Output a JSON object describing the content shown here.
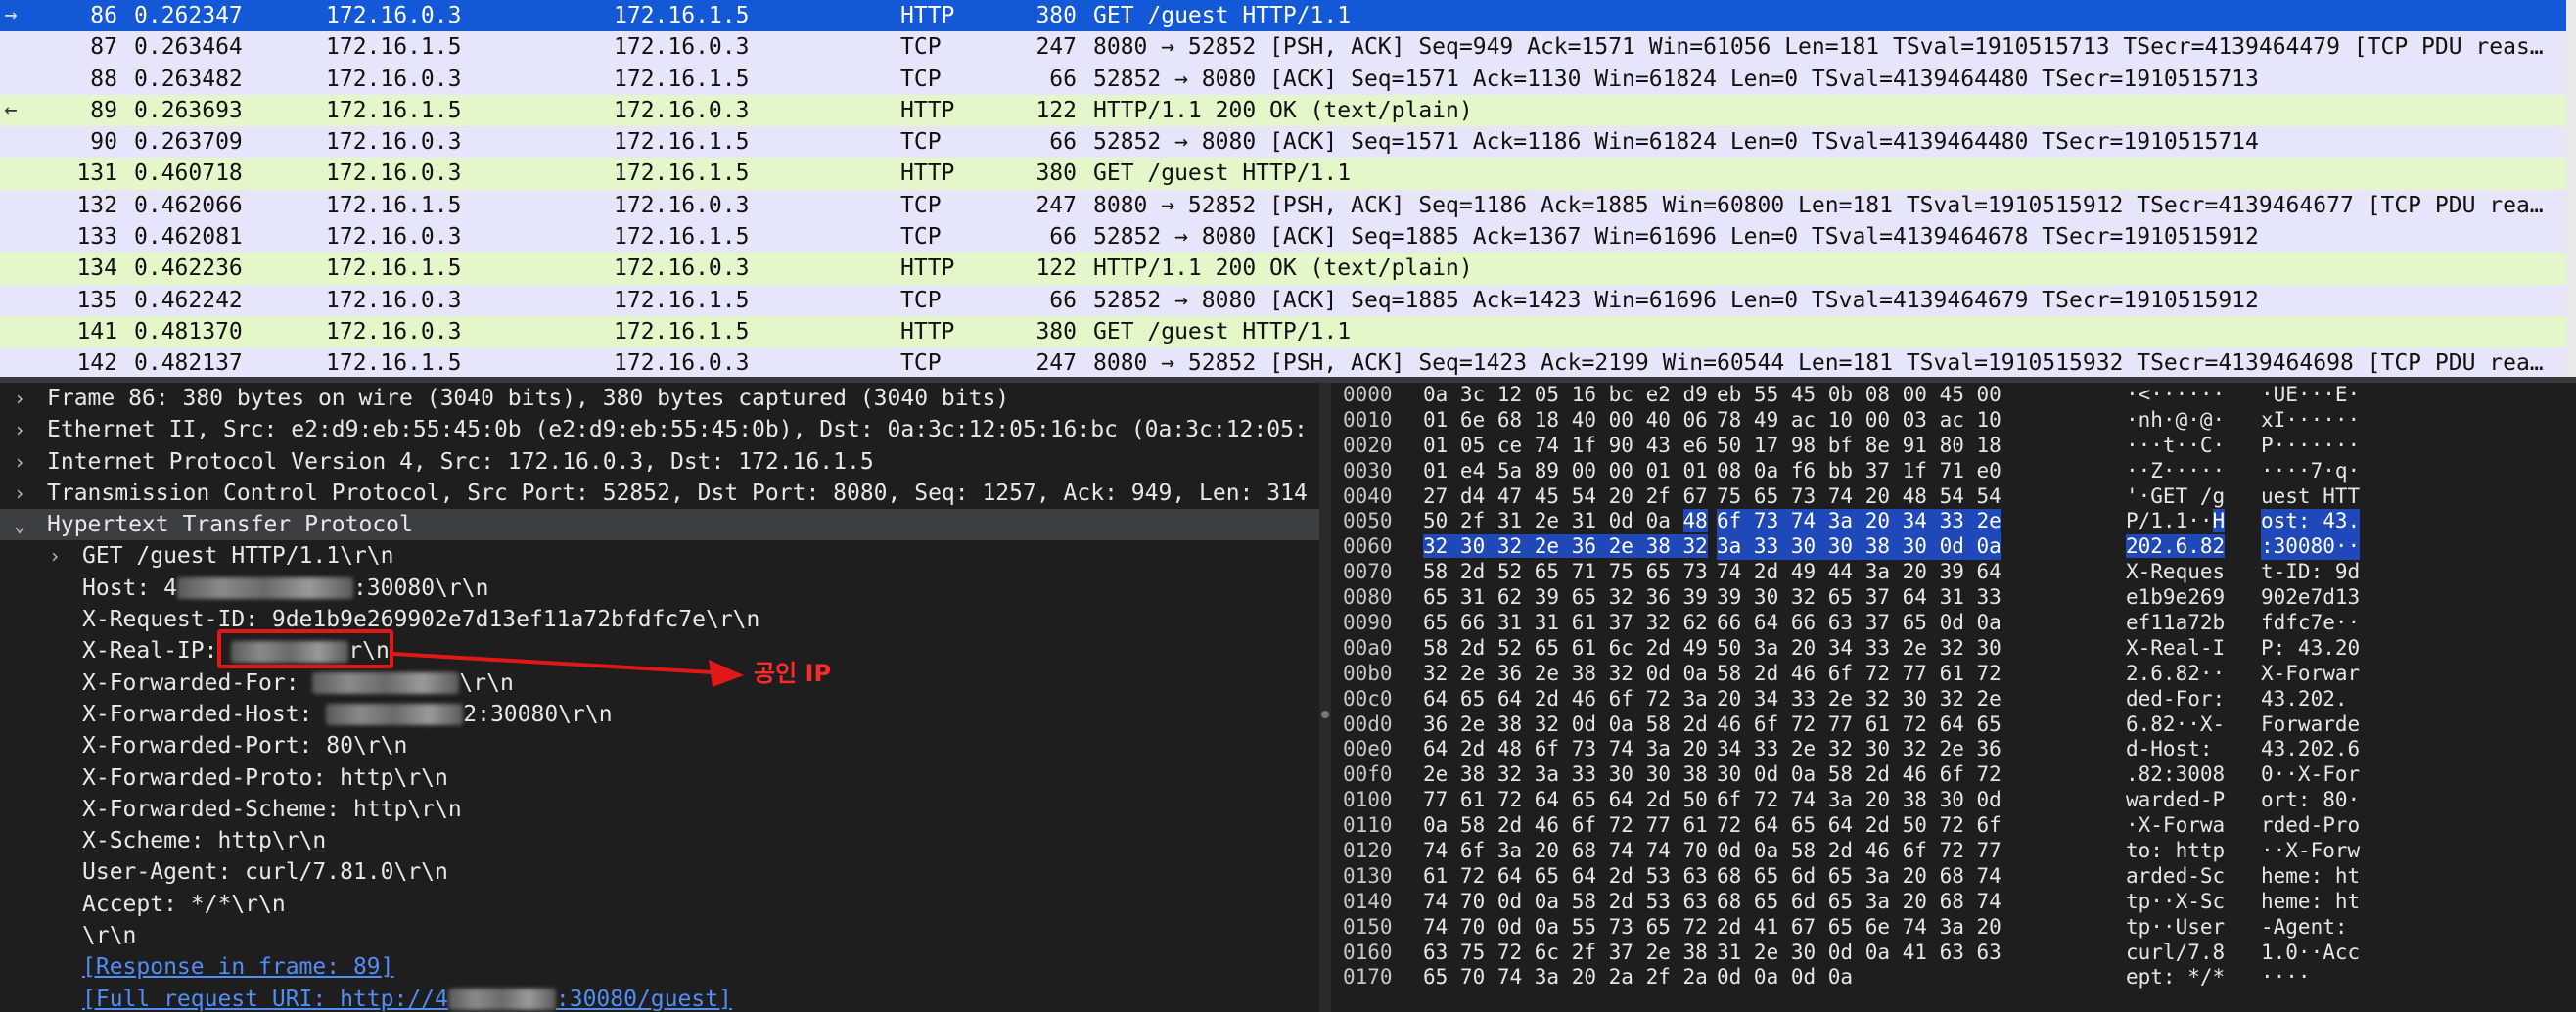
{
  "colors": {
    "http_row": "#e4f7c8",
    "tcp_row": "#e6e6fa",
    "selected_row": "#1358d6",
    "annotation_red": "#e01818"
  },
  "packets": [
    {
      "no": "86",
      "time": "0.262347",
      "src": "172.16.0.3",
      "dst": "172.16.1.5",
      "proto": "HTTP",
      "len": "380",
      "info": "GET /guest HTTP/1.1",
      "kind": "sel",
      "mark": "→"
    },
    {
      "no": "87",
      "time": "0.263464",
      "src": "172.16.1.5",
      "dst": "172.16.0.3",
      "proto": "TCP",
      "len": "247",
      "info": "8080 → 52852 [PSH, ACK] Seq=949 Ack=1571 Win=61056 Len=181 TSval=1910515713 TSecr=4139464479 [TCP PDU reas…",
      "kind": "tcp",
      "mark": ""
    },
    {
      "no": "88",
      "time": "0.263482",
      "src": "172.16.0.3",
      "dst": "172.16.1.5",
      "proto": "TCP",
      "len": "66",
      "info": "52852 → 8080 [ACK] Seq=1571 Ack=1130 Win=61824 Len=0 TSval=4139464480 TSecr=1910515713",
      "kind": "tcp",
      "mark": ""
    },
    {
      "no": "89",
      "time": "0.263693",
      "src": "172.16.1.5",
      "dst": "172.16.0.3",
      "proto": "HTTP",
      "len": "122",
      "info": "HTTP/1.1 200 OK  (text/plain)",
      "kind": "http",
      "mark": "←"
    },
    {
      "no": "90",
      "time": "0.263709",
      "src": "172.16.0.3",
      "dst": "172.16.1.5",
      "proto": "TCP",
      "len": "66",
      "info": "52852 → 8080 [ACK] Seq=1571 Ack=1186 Win=61824 Len=0 TSval=4139464480 TSecr=1910515714",
      "kind": "tcp",
      "mark": ""
    },
    {
      "no": "131",
      "time": "0.460718",
      "src": "172.16.0.3",
      "dst": "172.16.1.5",
      "proto": "HTTP",
      "len": "380",
      "info": "GET /guest HTTP/1.1",
      "kind": "http",
      "mark": ""
    },
    {
      "no": "132",
      "time": "0.462066",
      "src": "172.16.1.5",
      "dst": "172.16.0.3",
      "proto": "TCP",
      "len": "247",
      "info": "8080 → 52852 [PSH, ACK] Seq=1186 Ack=1885 Win=60800 Len=181 TSval=1910515912 TSecr=4139464677 [TCP PDU rea…",
      "kind": "tcp",
      "mark": ""
    },
    {
      "no": "133",
      "time": "0.462081",
      "src": "172.16.0.3",
      "dst": "172.16.1.5",
      "proto": "TCP",
      "len": "66",
      "info": "52852 → 8080 [ACK] Seq=1885 Ack=1367 Win=61696 Len=0 TSval=4139464678 TSecr=1910515912",
      "kind": "tcp",
      "mark": ""
    },
    {
      "no": "134",
      "time": "0.462236",
      "src": "172.16.1.5",
      "dst": "172.16.0.3",
      "proto": "HTTP",
      "len": "122",
      "info": "HTTP/1.1 200 OK  (text/plain)",
      "kind": "http",
      "mark": ""
    },
    {
      "no": "135",
      "time": "0.462242",
      "src": "172.16.0.3",
      "dst": "172.16.1.5",
      "proto": "TCP",
      "len": "66",
      "info": "52852 → 8080 [ACK] Seq=1885 Ack=1423 Win=61696 Len=0 TSval=4139464679 TSecr=1910515912",
      "kind": "tcp",
      "mark": ""
    },
    {
      "no": "141",
      "time": "0.481370",
      "src": "172.16.0.3",
      "dst": "172.16.1.5",
      "proto": "HTTP",
      "len": "380",
      "info": "GET /guest HTTP/1.1",
      "kind": "http",
      "mark": ""
    },
    {
      "no": "142",
      "time": "0.482137",
      "src": "172.16.1.5",
      "dst": "172.16.0.3",
      "proto": "TCP",
      "len": "247",
      "info": "8080 → 52852 [PSH, ACK] Seq=1423 Ack=2199 Win=60544 Len=181 TSval=1910515932 TSecr=4139464698 [TCP PDU rea…",
      "kind": "tcp",
      "mark": ""
    }
  ],
  "details": [
    {
      "caret": "›",
      "text": "Frame 86: 380 bytes on wire (3040 bits), 380 bytes captured (3040 bits)"
    },
    {
      "caret": "›",
      "text": "Ethernet II, Src: e2:d9:eb:55:45:0b (e2:d9:eb:55:45:0b), Dst: 0a:3c:12:05:16:bc (0a:3c:12:05:"
    },
    {
      "caret": "›",
      "text": "Internet Protocol Version 4, Src: 172.16.0.3, Dst: 172.16.1.5"
    },
    {
      "caret": "›",
      "text": "Transmission Control Protocol, Src Port: 52852, Dst Port: 8080, Seq: 1257, Ack: 949, Len: 314"
    },
    {
      "caret": "⌄",
      "text": "Hypertext Transfer Protocol"
    }
  ],
  "http": {
    "request_line": "GET /guest HTTP/1.1\\r\\n",
    "host_prefix": "Host: ",
    "host_suffix": ":30080\\r\\n",
    "host_lead": "4",
    "request_id": "X-Request-ID: 9de1b9e269902e7d13ef11a72bfdfc7e\\r\\n",
    "real_ip_prefix": "X-Real-IP: ",
    "real_ip_suffix": "r\\n",
    "forwarded_for_prefix": "X-Forwarded-For: ",
    "forwarded_for_suffix": "\\r\\n",
    "forwarded_host_prefix": "X-Forwarded-Host: ",
    "forwarded_host_suffix": "2:30080\\r\\n",
    "forwarded_port": "X-Forwarded-Port: 80\\r\\n",
    "forwarded_proto": "X-Forwarded-Proto: http\\r\\n",
    "forwarded_scheme": "X-Forwarded-Scheme: http\\r\\n",
    "x_scheme": "X-Scheme: http\\r\\n",
    "user_agent": "User-Agent: curl/7.81.0\\r\\n",
    "accept": "Accept: */*\\r\\n",
    "crlf": "\\r\\n",
    "response_link": "[Response in frame: 89]",
    "full_uri_prefix": "[Full request URI: http://4",
    "full_uri_suffix": ":30080/guest]"
  },
  "annotation": {
    "label": "공인 IP"
  },
  "hex": [
    {
      "off": "0000",
      "b1": "0a 3c 12 05 16 bc e2 d9",
      "b2": "eb 55 45 0b 08 00 45 00",
      "a1": "·<······",
      "a2": "·UE···E·"
    },
    {
      "off": "0010",
      "b1": "01 6e 68 18 40 00 40 06",
      "b2": "78 49 ac 10 00 03 ac 10",
      "a1": "·nh·@·@·",
      "a2": "xI······"
    },
    {
      "off": "0020",
      "b1": "01 05 ce 74 1f 90 43 e6",
      "b2": "50 17 98 bf 8e 91 80 18",
      "a1": "···t··C·",
      "a2": "P·······"
    },
    {
      "off": "0030",
      "b1": "01 e4 5a 89 00 00 01 01",
      "b2": "08 0a f6 bb 37 1f 71 e0",
      "a1": "··Z·····",
      "a2": "····7·q·"
    },
    {
      "off": "0040",
      "b1": "27 d4 47 45 54 20 2f 67",
      "b2": "75 65 73 74 20 48 54 54",
      "a1": "'·GET /g",
      "a2": "uest HTT"
    },
    {
      "off": "0050",
      "b1": "50 2f 31 2e 31 0d 0a",
      "b1h": "48",
      "b2": "6f 73 74 3a 20 34 33 2e",
      "a1": "P/1.1··",
      "a1h": "H",
      "a2": "ost: 43.",
      "hl2": true
    },
    {
      "off": "0060",
      "b1": "32 30 32 2e 36 2e 38 32",
      "b2": "3a 33 30 30 38 30 0d 0a",
      "a1": "202.6.82",
      "a2": ":30080··",
      "hlall": true
    },
    {
      "off": "0070",
      "b1": "58 2d 52 65 71 75 65 73",
      "b2": "74 2d 49 44 3a 20 39 64",
      "a1": "X-Reques",
      "a2": "t-ID: 9d"
    },
    {
      "off": "0080",
      "b1": "65 31 62 39 65 32 36 39",
      "b2": "39 30 32 65 37 64 31 33",
      "a1": "e1b9e269",
      "a2": "902e7d13"
    },
    {
      "off": "0090",
      "b1": "65 66 31 31 61 37 32 62",
      "b2": "66 64 66 63 37 65 0d 0a",
      "a1": "ef11a72b",
      "a2": "fdfc7e··"
    },
    {
      "off": "00a0",
      "b1": "58 2d 52 65 61 6c 2d 49",
      "b2": "50 3a 20 34 33 2e 32 30",
      "a1": "X-Real-I",
      "a2": "P: 43.20"
    },
    {
      "off": "00b0",
      "b1": "32 2e 36 2e 38 32 0d 0a",
      "b2": "58 2d 46 6f 72 77 61 72",
      "a1": "2.6.82··",
      "a2": "X-Forwar"
    },
    {
      "off": "00c0",
      "b1": "64 65 64 2d 46 6f 72 3a",
      "b2": "20 34 33 2e 32 30 32 2e",
      "a1": "ded-For:",
      "a2": " 43.202."
    },
    {
      "off": "00d0",
      "b1": "36 2e 38 32 0d 0a 58 2d",
      "b2": "46 6f 72 77 61 72 64 65",
      "a1": "6.82··X-",
      "a2": "Forwarde"
    },
    {
      "off": "00e0",
      "b1": "64 2d 48 6f 73 74 3a 20",
      "b2": "34 33 2e 32 30 32 2e 36",
      "a1": "d-Host: ",
      "a2": "43.202.6"
    },
    {
      "off": "00f0",
      "b1": "2e 38 32 3a 33 30 30 38",
      "b2": "30 0d 0a 58 2d 46 6f 72",
      "a1": ".82:3008",
      "a2": "0··X-For"
    },
    {
      "off": "0100",
      "b1": "77 61 72 64 65 64 2d 50",
      "b2": "6f 72 74 3a 20 38 30 0d",
      "a1": "warded-P",
      "a2": "ort: 80·"
    },
    {
      "off": "0110",
      "b1": "0a 58 2d 46 6f 72 77 61",
      "b2": "72 64 65 64 2d 50 72 6f",
      "a1": "·X-Forwa",
      "a2": "rded-Pro"
    },
    {
      "off": "0120",
      "b1": "74 6f 3a 20 68 74 74 70",
      "b2": "0d 0a 58 2d 46 6f 72 77",
      "a1": "to: http",
      "a2": "··X-Forw"
    },
    {
      "off": "0130",
      "b1": "61 72 64 65 64 2d 53 63",
      "b2": "68 65 6d 65 3a 20 68 74",
      "a1": "arded-Sc",
      "a2": "heme: ht"
    },
    {
      "off": "0140",
      "b1": "74 70 0d 0a 58 2d 53 63",
      "b2": "68 65 6d 65 3a 20 68 74",
      "a1": "tp··X-Sc",
      "a2": "heme: ht"
    },
    {
      "off": "0150",
      "b1": "74 70 0d 0a 55 73 65 72",
      "b2": "2d 41 67 65 6e 74 3a 20",
      "a1": "tp··User",
      "a2": "-Agent: "
    },
    {
      "off": "0160",
      "b1": "63 75 72 6c 2f 37 2e 38",
      "b2": "31 2e 30 0d 0a 41 63 63",
      "a1": "curl/7.8",
      "a2": "1.0··Acc"
    },
    {
      "off": "0170",
      "b1": "65 70 74 3a 20 2a 2f 2a",
      "b2": "0d 0a 0d 0a",
      "a1": "ept: */*",
      "a2": "····"
    }
  ]
}
